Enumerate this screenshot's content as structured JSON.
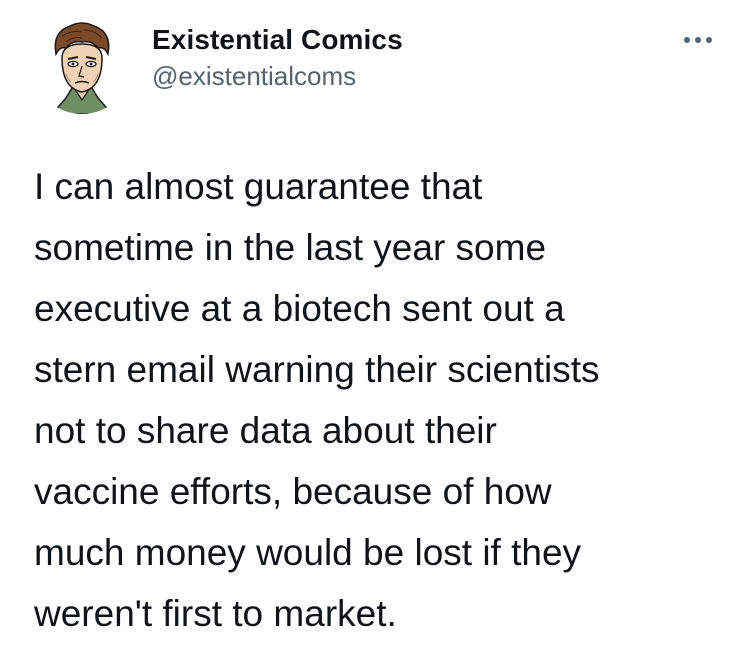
{
  "author": {
    "display_name": "Existential Comics",
    "handle": "@existentialcoms",
    "avatar_icon": "cartoon-philosopher-portrait-icon"
  },
  "menu": {
    "icon": "more-options-icon"
  },
  "tweet": {
    "lines": [
      "I can almost guarantee that",
      "sometime in the last year some",
      "executive at a biotech sent out a",
      "stern email warning their scientists",
      "not to share data about their",
      "vaccine efforts, because of how",
      "much money would be lost if they",
      "weren't first to market."
    ]
  },
  "colors": {
    "text": "#0f1419",
    "secondary": "#536471",
    "background": "#ffffff"
  }
}
